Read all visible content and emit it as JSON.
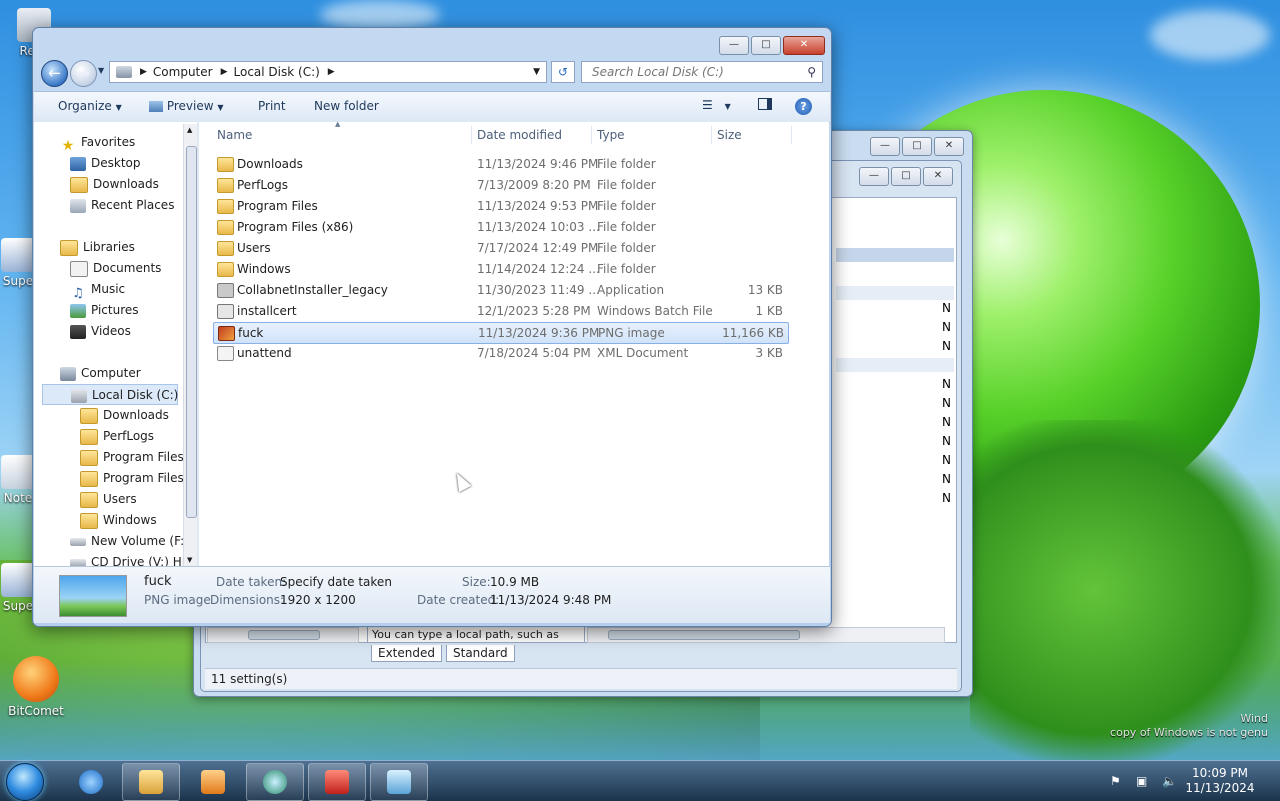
{
  "desktop": {
    "icons": [
      {
        "label": "Recy"
      },
      {
        "label": "Supe"
      },
      {
        "label": "Note"
      },
      {
        "label": "Supe"
      },
      {
        "label": "BitComet"
      }
    ],
    "watermark_line1": "Wind",
    "watermark_line2": "copy of Windows is not genu"
  },
  "background_window": {
    "status": "11 setting(s)",
    "path_hint": "You can type a local path, such as",
    "tabs": [
      "Extended",
      "Standard"
    ],
    "n_marker": "N"
  },
  "explorer": {
    "address": {
      "crumbs": [
        "Computer",
        "Local Disk (C:)"
      ]
    },
    "search_placeholder": "Search Local Disk (C:)",
    "toolbar": {
      "organize": "Organize",
      "preview": "Preview",
      "print": "Print",
      "new_folder": "New folder"
    },
    "nav": {
      "favorites": "Favorites",
      "desktop": "Desktop",
      "downloads": "Downloads",
      "recent_places": "Recent Places",
      "libraries": "Libraries",
      "documents": "Documents",
      "music": "Music",
      "pictures": "Pictures",
      "videos": "Videos",
      "computer": "Computer",
      "local_disk": "Local Disk (C:)",
      "c_downloads": "Downloads",
      "c_perflogs": "PerfLogs",
      "c_program_files": "Program Files",
      "c_program_files_x86": "Program Files (",
      "c_users": "Users",
      "c_windows": "Windows",
      "new_volume": "New Volume (F:)",
      "cd_drive": "CD Drive (V:) HM"
    },
    "columns": {
      "name": "Name",
      "date_modified": "Date modified",
      "type": "Type",
      "size": "Size"
    },
    "files": [
      {
        "name": "Downloads",
        "date": "11/13/2024 9:46 PM",
        "type": "File folder",
        "size": ""
      },
      {
        "name": "PerfLogs",
        "date": "7/13/2009 8:20 PM",
        "type": "File folder",
        "size": ""
      },
      {
        "name": "Program Files",
        "date": "11/13/2024 9:53 PM",
        "type": "File folder",
        "size": ""
      },
      {
        "name": "Program Files (x86)",
        "date": "11/13/2024 10:03 ...",
        "type": "File folder",
        "size": ""
      },
      {
        "name": "Users",
        "date": "7/17/2024 12:49 PM",
        "type": "File folder",
        "size": ""
      },
      {
        "name": "Windows",
        "date": "11/14/2024 12:24 ...",
        "type": "File folder",
        "size": ""
      },
      {
        "name": "CollabnetInstaller_legacy",
        "date": "11/30/2023 11:49 ...",
        "type": "Application",
        "size": "13 KB"
      },
      {
        "name": "installcert",
        "date": "12/1/2023 5:28 PM",
        "type": "Windows Batch File",
        "size": "1 KB"
      },
      {
        "name": "fuck",
        "date": "11/13/2024 9:36 PM",
        "type": "PNG image",
        "size": "11,166 KB"
      },
      {
        "name": "unattend",
        "date": "7/18/2024 5:04 PM",
        "type": "XML Document",
        "size": "3 KB"
      }
    ],
    "details": {
      "name": "fuck",
      "type": "PNG image",
      "date_taken_label": "Date taken:",
      "date_taken_value": "Specify date taken",
      "dimensions_label": "Dimensions:",
      "dimensions_value": "1920 x 1200",
      "size_label": "Size:",
      "size_value": "10.9 MB",
      "date_created_label": "Date created:",
      "date_created_value": "11/13/2024 9:48 PM"
    }
  },
  "taskbar": {
    "time": "10:09 PM",
    "date": "11/13/2024"
  }
}
